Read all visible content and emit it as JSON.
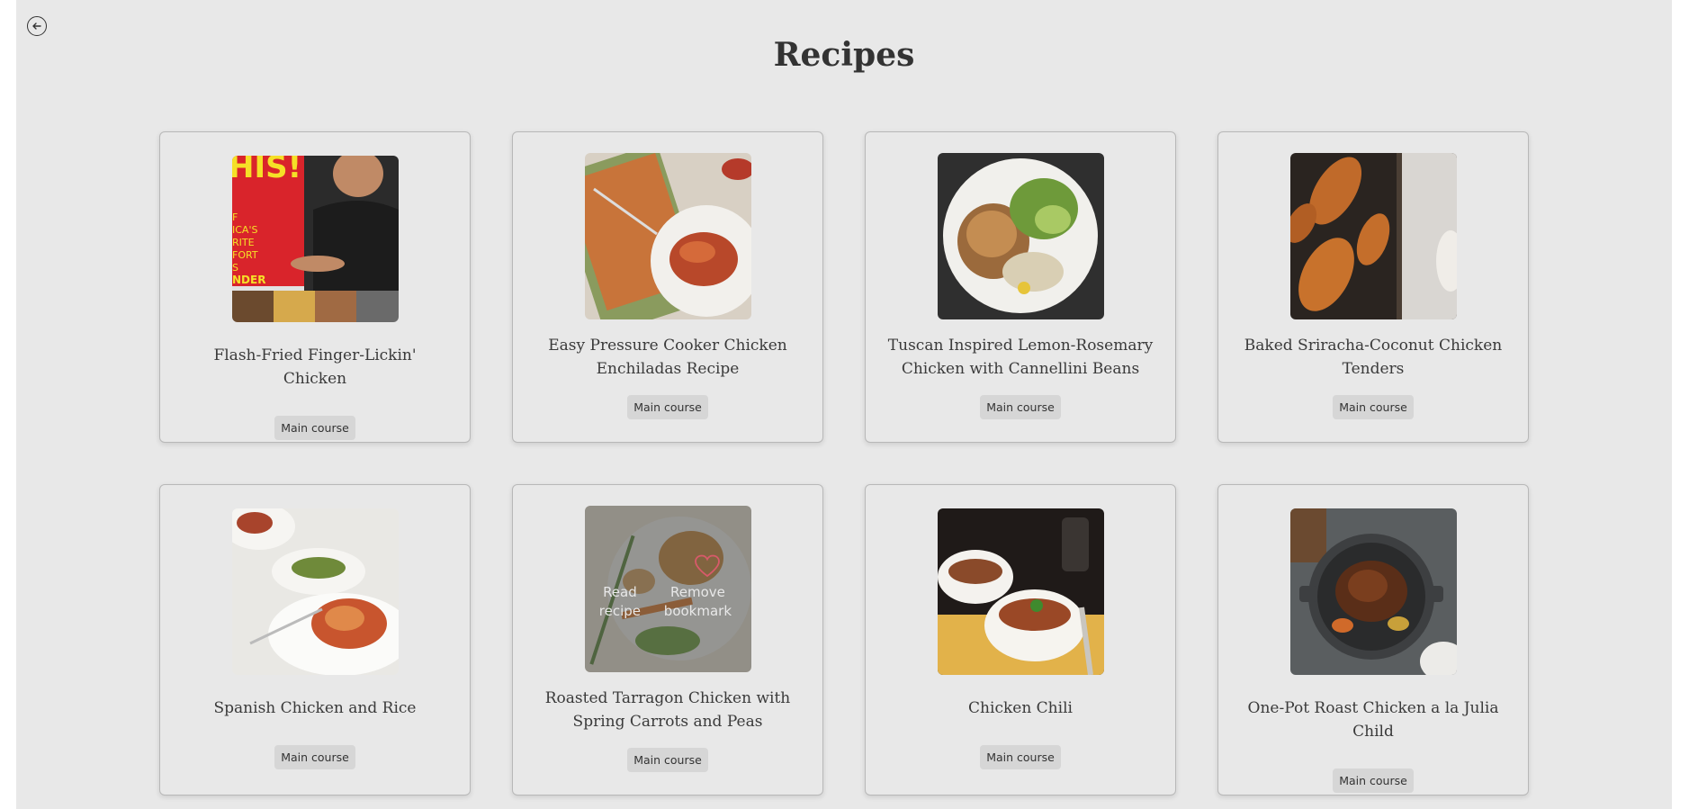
{
  "page": {
    "title": "Recipes",
    "back_icon": "arrow-left-circle-icon"
  },
  "recipes": [
    {
      "title": "Flash-Fried Finger-Lickin' Chicken",
      "category": "Main course",
      "image": "cookbook-cover-photo"
    },
    {
      "title": "Easy Pressure Cooker Chicken Enchiladas Recipe",
      "category": "Main course",
      "image": "enchiladas-photo"
    },
    {
      "title": "Tuscan Inspired Lemon-Rosemary Chicken with Cannellini Beans",
      "category": "Main course",
      "image": "lemon-rosemary-chicken-photo"
    },
    {
      "title": "Baked Sriracha-Coconut Chicken Tenders",
      "category": "Main course",
      "image": "chicken-tenders-photo"
    },
    {
      "title": "Spanish Chicken and Rice",
      "category": "Main course",
      "image": "spanish-chicken-rice-photo"
    },
    {
      "title": "Roasted Tarragon Chicken with Spring Carrots and Peas",
      "category": "Main course",
      "image": "tarragon-chicken-photo",
      "overlay": {
        "read": "Read recipe",
        "remove": "Remove bookmark",
        "icon": "heart-icon"
      }
    },
    {
      "title": "Chicken Chili",
      "category": "Main course",
      "image": "chicken-chili-photo"
    },
    {
      "title": "One-Pot Roast Chicken a la Julia Child",
      "category": "Main course",
      "image": "roast-chicken-pot-photo"
    }
  ]
}
